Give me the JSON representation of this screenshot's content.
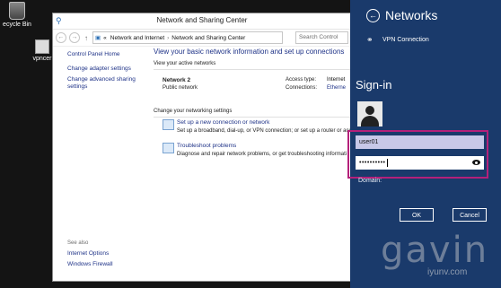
{
  "desktop": {
    "recycle_label": "ecycle Bin",
    "vpn_label": "vpncer"
  },
  "window": {
    "title": "Network and Sharing Center",
    "address": {
      "crumb_prefix": "«",
      "crumb1": "Network and Internet",
      "sep": "›",
      "crumb2": "Network and Sharing Center",
      "search_placeholder": "Search Control"
    },
    "sidebar": {
      "home": "Control Panel Home",
      "adapter": "Change adapter settings",
      "advanced": "Change advanced sharing settings",
      "see_also": "See also",
      "internet_options": "Internet Options",
      "firewall": "Windows Firewall"
    },
    "main": {
      "heading": "View your basic network information and set up connections",
      "active_networks": "View your active networks",
      "network_name": "Network 2",
      "network_type": "Public network",
      "access_type_label": "Access type:",
      "access_type_value": "Internet",
      "connections_label": "Connections:",
      "connections_value": "Etherne",
      "change_settings": "Change your networking settings",
      "task1_link": "Set up a new connection or network",
      "task1_desc": "Set up a broadband, dial-up, or VPN connection; or set up a router or acc",
      "task2_link": "Troubleshoot problems",
      "task2_desc": "Diagnose and repair network problems, or get troubleshooting informati"
    }
  },
  "flyout": {
    "title": "Networks",
    "vpn_connection": "VPN Connection",
    "signin_title": "Sign-in",
    "username_value": "user01",
    "password_mask": "••••••••••",
    "domain_label": "Domain:",
    "ok_label": "OK",
    "cancel_label": "Cancel",
    "highlight_color": "#b4207a",
    "background_color": "#1a3a6b"
  },
  "watermark": {
    "text": "gavin",
    "sub": "iyunv.com"
  }
}
